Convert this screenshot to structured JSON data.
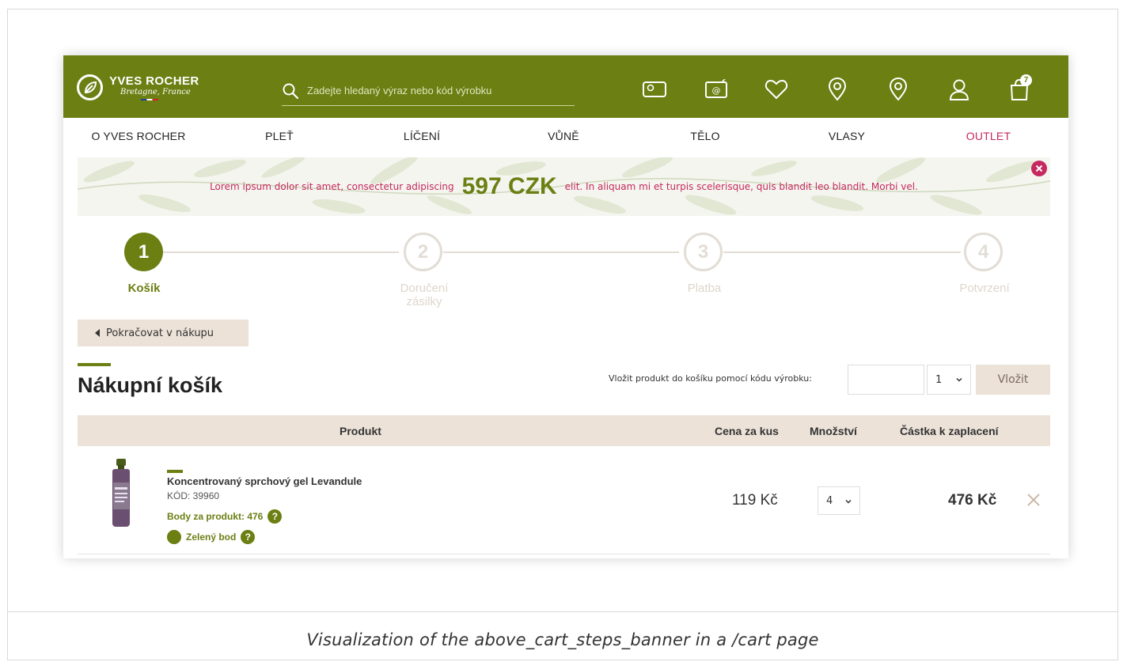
{
  "colors": {
    "brand_green": "#6b7f13",
    "accent_pink": "#c6285f",
    "beige": "#ece2d8",
    "step_idle": "#e2ddd5"
  },
  "header": {
    "logo": {
      "brand": "YVES ROCHER",
      "tagline": "Bretagne, France"
    },
    "search": {
      "placeholder": "Zadejte hledaný výraz nebo kód výrobku"
    },
    "icons": [
      "card-icon",
      "newsletter-icon",
      "heart-icon",
      "location-icon",
      "store-location-icon",
      "user-icon",
      "shopping-bag-icon"
    ],
    "cart_count": "7"
  },
  "nav": {
    "items": [
      {
        "label": "O YVES ROCHER"
      },
      {
        "label": "PLEŤ"
      },
      {
        "label": "LÍČENÍ"
      },
      {
        "label": "VŮNĚ"
      },
      {
        "label": "TĚLO"
      },
      {
        "label": "VLASY"
      },
      {
        "label": "OUTLET"
      }
    ]
  },
  "banner": {
    "text_before": "Lorem ipsum dolor sit amet, consectetur adipiscing",
    "amount": "597 CZK",
    "text_after": "elit. In aliquam mi et turpis scelerisque, quis blandit leo blandit. Morbi vel."
  },
  "steps": [
    {
      "number": "1",
      "label": "Košík",
      "active": true
    },
    {
      "number": "2",
      "label": "Doručení zásilky",
      "active": false
    },
    {
      "number": "3",
      "label": "Platba",
      "active": false
    },
    {
      "number": "4",
      "label": "Potvrzení",
      "active": false
    }
  ],
  "continue_label": "Pokračovat v nákupu",
  "cart": {
    "title": "Nákupní košík",
    "add_by_code_label": "Vložit produkt do košíku pomocí kódu výrobku:",
    "add_qty": "1",
    "insert_label": "Vložit",
    "columns": {
      "product": "Produkt",
      "unit_price": "Cena za kus",
      "quantity": "Množství",
      "total": "Částka k zaplacení"
    },
    "items": [
      {
        "name": "Koncentrovaný sprchový gel Levandule",
        "code": "KÓD: 39960",
        "points": "Body za produkt: 476",
        "green_point": "Zelený bod",
        "unit_price": "119 Kč",
        "quantity": "4",
        "total": "476 Kč"
      }
    ]
  },
  "caption": "Visualization of the above_cart_steps_banner in a /cart page"
}
